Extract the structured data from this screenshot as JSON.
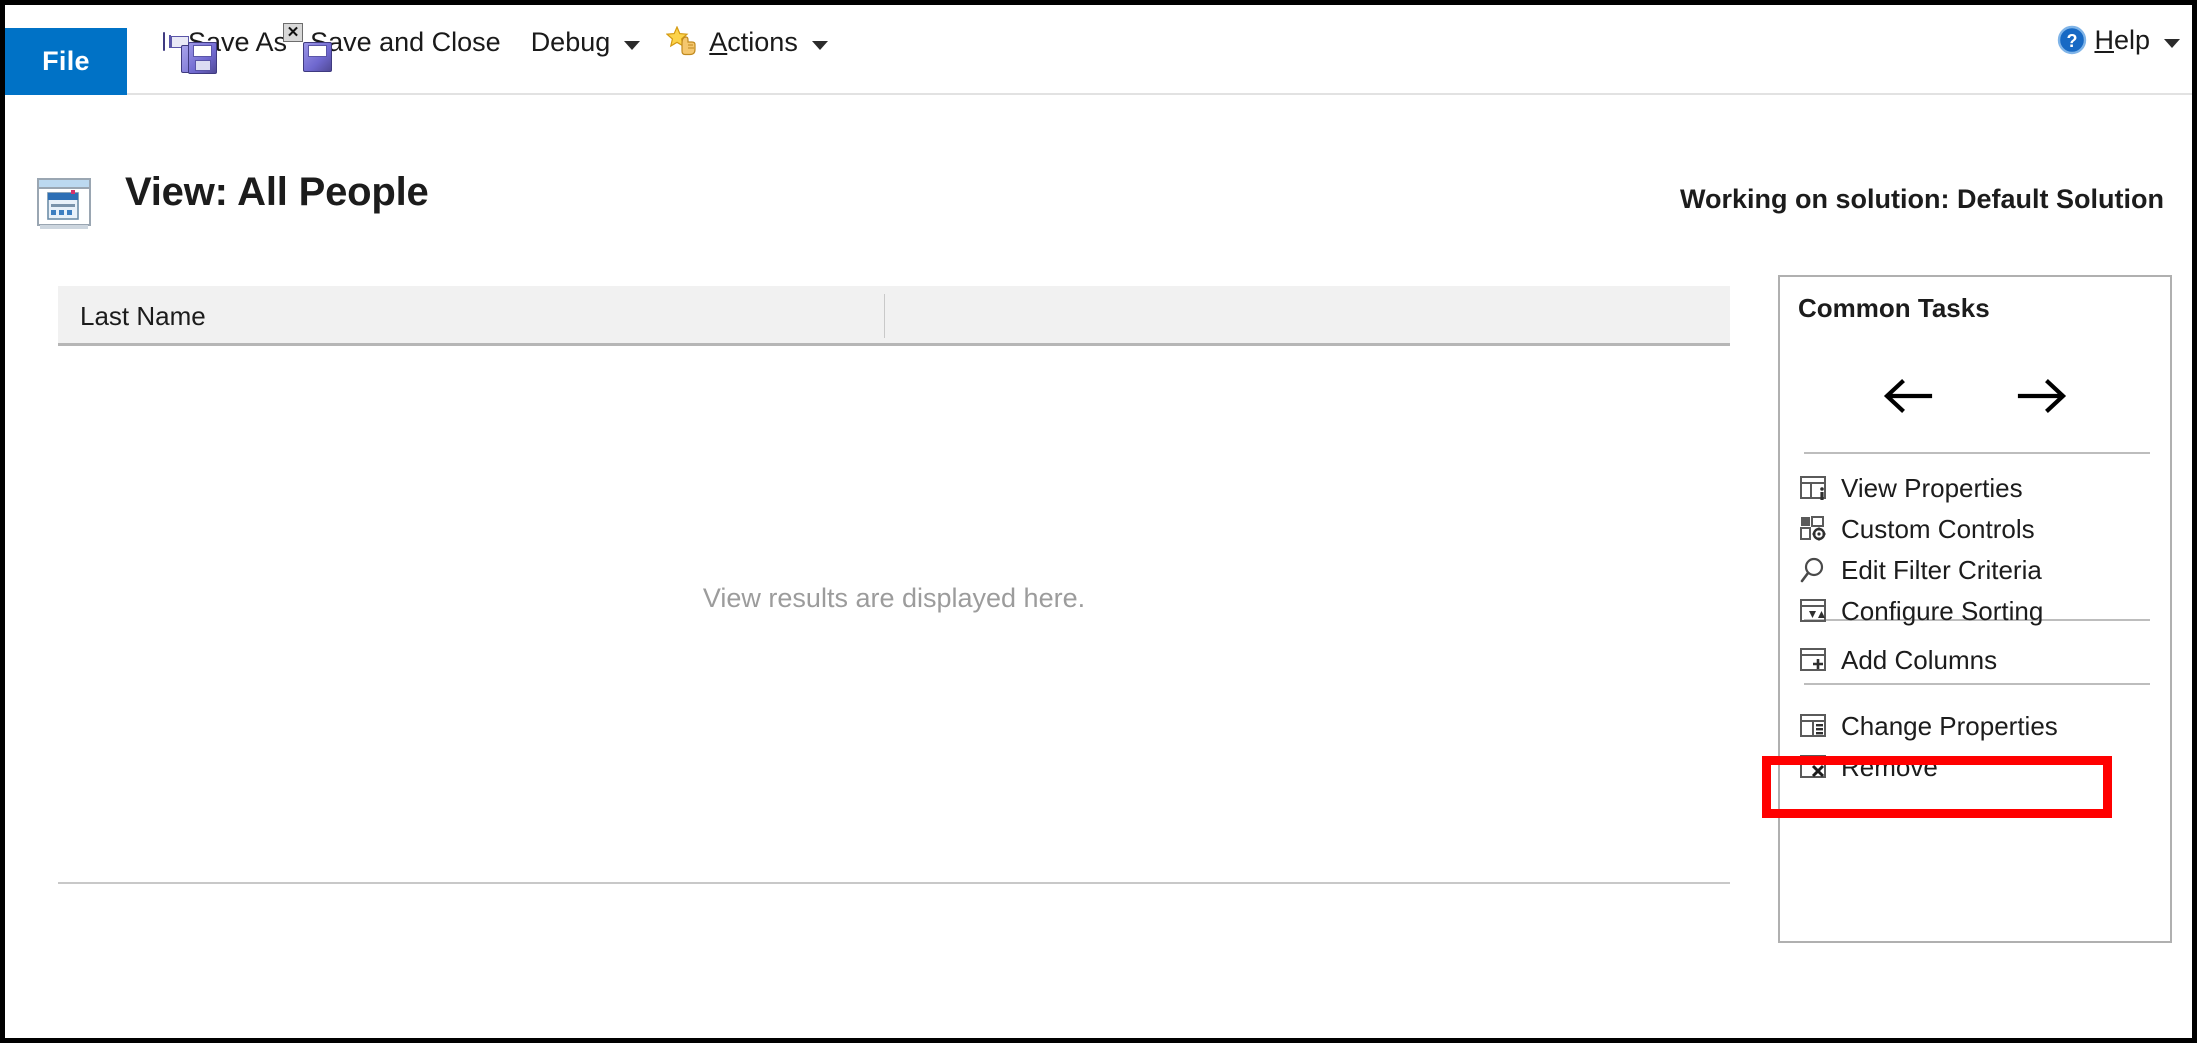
{
  "window": {
    "file_tab_label": "File"
  },
  "toolbar": {
    "items": [
      {
        "label": "",
        "icon": "save-icon",
        "has_caret": false
      },
      {
        "label": "Save As",
        "icon": "save-as-icon",
        "has_caret": false
      },
      {
        "label": "Save and Close",
        "icon": "save-and-close-icon",
        "has_caret": false
      },
      {
        "label": "Debug",
        "icon": "none",
        "has_caret": true
      },
      {
        "label": "Actions",
        "icon": "actions-star-icon",
        "has_caret": true
      }
    ],
    "help": {
      "label": "Help",
      "icon": "help-icon",
      "has_caret": true
    }
  },
  "header": {
    "icon": "view-window-icon",
    "title": "View: All People",
    "solution_status": "Working on solution: Default Solution"
  },
  "grid": {
    "columns": [
      "Last Name"
    ],
    "rows": [],
    "empty_message": "View results are displayed here."
  },
  "common_tasks": {
    "title": "Common Tasks",
    "nav": {
      "back_icon": "arrow-left-icon",
      "forward_icon": "arrow-right-icon"
    },
    "items": [
      {
        "label": "View Properties",
        "icon": "view-properties-icon"
      },
      {
        "label": "Custom Controls",
        "icon": "custom-controls-icon"
      },
      {
        "label": "Edit Filter Criteria",
        "icon": "magnifier-icon"
      },
      {
        "label": "Configure Sorting",
        "icon": "configure-sorting-icon"
      },
      {
        "label": "Add Columns",
        "icon": "add-columns-icon"
      },
      {
        "label": "Change Properties",
        "icon": "change-properties-icon"
      },
      {
        "label": "Remove",
        "icon": "remove-column-icon"
      }
    ]
  },
  "annotation": {
    "highlight_target": "Add Columns",
    "highlight_color": "#ff0000"
  }
}
